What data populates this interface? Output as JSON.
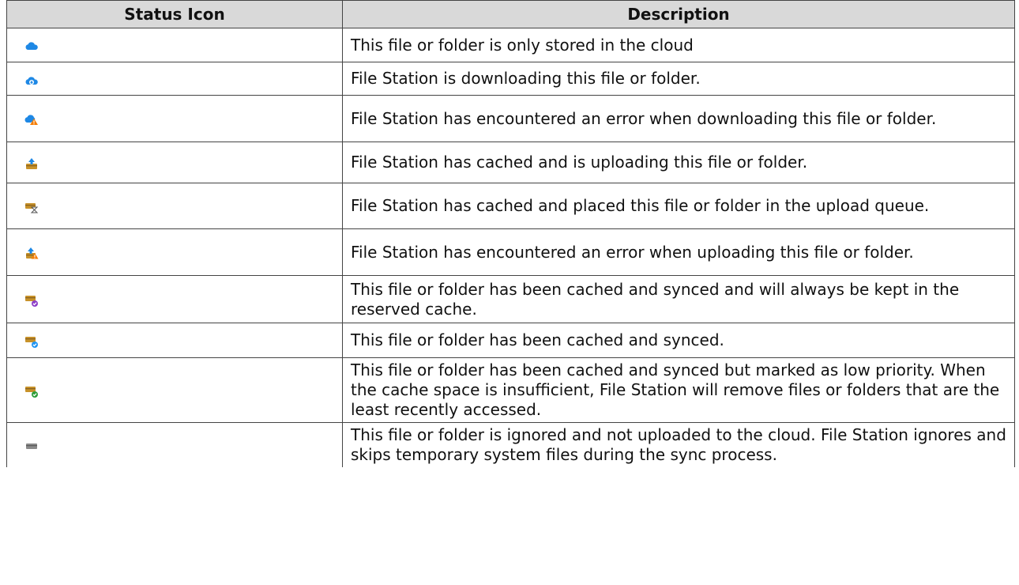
{
  "table": {
    "headers": [
      "Status Icon",
      "Description"
    ],
    "rows": [
      {
        "icon": "cloud-only-icon",
        "description": "This file or folder is only stored in the cloud"
      },
      {
        "icon": "cloud-downloading-icon",
        "description": "File Station is downloading this file or folder."
      },
      {
        "icon": "cloud-download-error-icon",
        "description": "File Station has encountered an error when downloading this file or folder."
      },
      {
        "icon": "cache-uploading-icon",
        "description": "File Station has cached and is uploading this file or folder."
      },
      {
        "icon": "cache-upload-queue-icon",
        "description": "File Station has cached and placed this file or folder in the upload queue."
      },
      {
        "icon": "cache-upload-error-icon",
        "description": "File Station has encountered an error when uploading this file or folder."
      },
      {
        "icon": "cache-synced-reserved-icon",
        "description": "This file or folder has been cached and synced and will always be kept in the reserved cache."
      },
      {
        "icon": "cache-synced-icon",
        "description": "This file or folder has been cached and synced."
      },
      {
        "icon": "cache-synced-low-priority-icon",
        "description": "This file or folder has been cached and synced but marked as low priority. When the cache space is insufficient, File Station will remove files or folders that are the least recently accessed."
      },
      {
        "icon": "ignored-icon",
        "description": "This file or folder is ignored and not uploaded to the cloud. File Station ignores and skips temporary system files during the sync process."
      }
    ]
  },
  "colors": {
    "cloud": "#1e88e5",
    "box": "#c8922a",
    "error": "#f57c00",
    "reserved": "#8e3fc9",
    "synced": "#2196f3",
    "low_priority": "#2e9e3a",
    "ignored": "#8a8a8a"
  }
}
